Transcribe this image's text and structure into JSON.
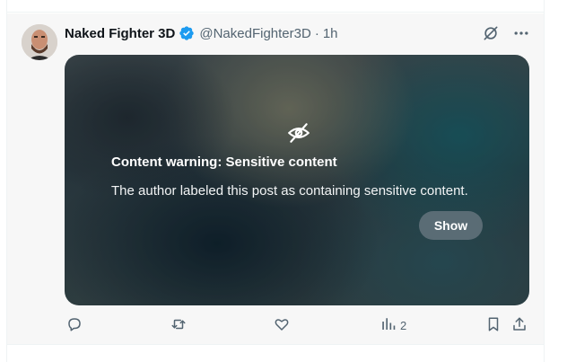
{
  "tweet": {
    "author": {
      "display_name": "Naked Fighter 3D",
      "handle": "@NakedFighter3D",
      "verified": true
    },
    "separator": "·",
    "time": "1h",
    "header_icons": [
      "grok-icon",
      "more-icon"
    ],
    "media": {
      "warning_icon": "eye-slash-icon",
      "warning_title": "Content warning: Sensitive content",
      "warning_text": "The author labeled this post as containing sensitive content.",
      "show_label": "Show"
    },
    "actions": {
      "reply_icon": "reply-icon",
      "repost_icon": "repost-icon",
      "like_icon": "like-icon",
      "views_icon": "views-icon",
      "views_count": "2",
      "bookmark_icon": "bookmark-icon",
      "share_icon": "share-icon"
    }
  },
  "colors": {
    "verified_badge": "#1d9bf0",
    "secondary_text": "#536471",
    "tweet_background": "#f7f7f7",
    "show_button": "#64737d"
  }
}
